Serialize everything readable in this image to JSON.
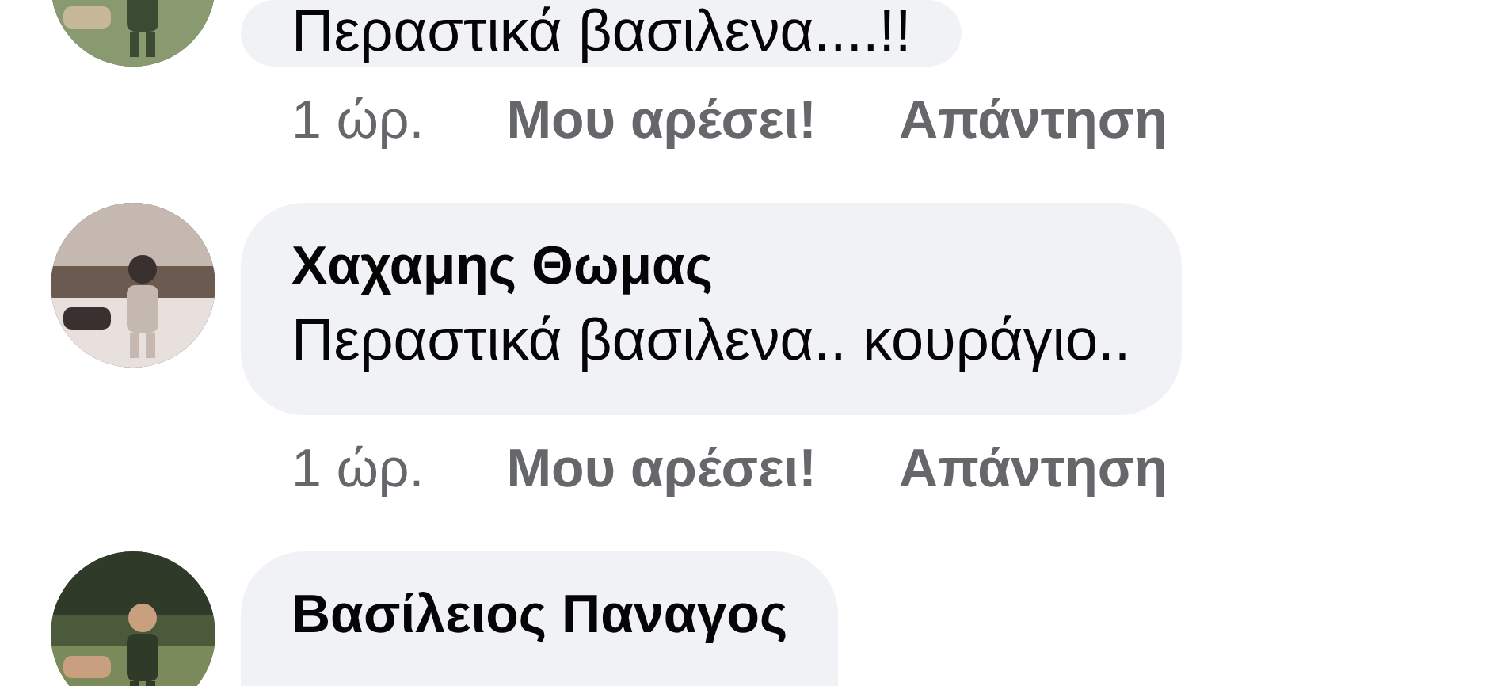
{
  "comments": [
    {
      "text": "Περαστικά βασιλενα....!!",
      "actions": {
        "time": "1 ώρ.",
        "like": "Μου αρέσει!",
        "reply": "Απάντηση"
      }
    },
    {
      "author": "Χαχαμης Θωμας",
      "text": "Περαστικά βασιλενα.. κουράγιο..",
      "actions": {
        "time": "1 ώρ.",
        "like": "Μου αρέσει!",
        "reply": "Απάντηση"
      }
    },
    {
      "author": "Βασίλειος Παναγος"
    }
  ]
}
